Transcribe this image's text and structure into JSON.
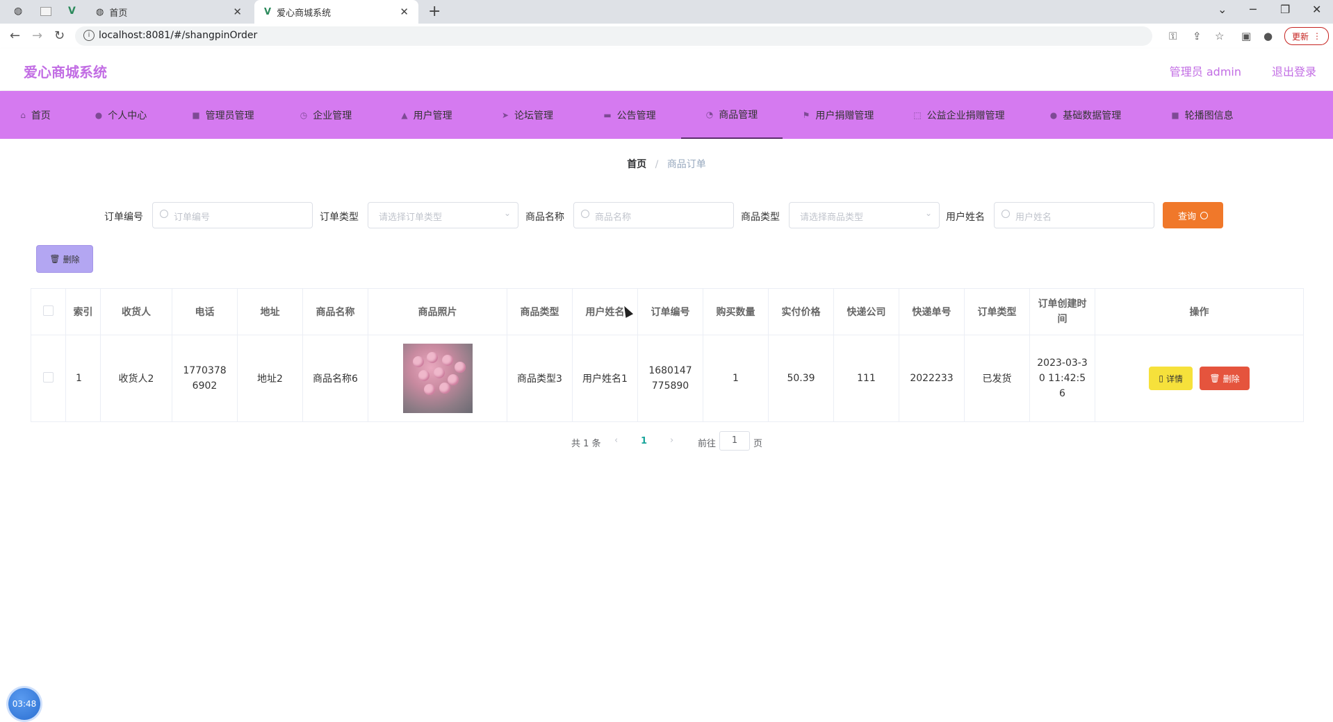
{
  "browser": {
    "tabs": [
      {
        "title": "首页"
      },
      {
        "title": "爱心商城系统"
      }
    ],
    "url": "localhost:8081/#/shangpinOrder",
    "update_label": "更新"
  },
  "header": {
    "app_title": "爱心商城系统",
    "admin_label": "管理员 admin",
    "logout_label": "退出登录"
  },
  "nav": {
    "items": [
      {
        "label": "首页"
      },
      {
        "label": "个人中心"
      },
      {
        "label": "管理员管理"
      },
      {
        "label": "企业管理"
      },
      {
        "label": "用户管理"
      },
      {
        "label": "论坛管理"
      },
      {
        "label": "公告管理"
      },
      {
        "label": "商品管理"
      },
      {
        "label": "用户捐赠管理"
      },
      {
        "label": "公益企业捐赠管理"
      },
      {
        "label": "基础数据管理"
      },
      {
        "label": "轮播图信息"
      }
    ],
    "active": "商品管理"
  },
  "breadcrumb": {
    "home": "首页",
    "separator": "/",
    "current": "商品订单"
  },
  "search": {
    "order_no_label": "订单编号",
    "order_no_placeholder": "订单编号",
    "order_type_label": "订单类型",
    "order_type_placeholder": "请选择订单类型",
    "product_name_label": "商品名称",
    "product_name_placeholder": "商品名称",
    "product_type_label": "商品类型",
    "product_type_placeholder": "请选择商品类型",
    "user_name_label": "用户姓名",
    "user_name_placeholder": "用户姓名",
    "query_label": "查询"
  },
  "toolbar": {
    "delete_label": "删除"
  },
  "table": {
    "columns": [
      "索引",
      "收货人",
      "电话",
      "地址",
      "商品名称",
      "商品照片",
      "商品类型",
      "用户姓名",
      "订单编号",
      "购买数量",
      "实付价格",
      "快递公司",
      "快递单号",
      "订单类型",
      "订单创建时间",
      "操作"
    ],
    "rows": [
      {
        "index": "1",
        "receiver": "收货人2",
        "phone": "17703786902",
        "address": "地址2",
        "product_name": "商品名称6",
        "product_type": "商品类型3",
        "user_name": "用户姓名1",
        "order_no": "1680147775890",
        "quantity": "1",
        "price": "50.39",
        "courier": "111",
        "tracking_no": "2022233",
        "order_type": "已发货",
        "created_at": "2023-03-30 11:42:56",
        "detail_label": "详情",
        "delete_label": "删除"
      }
    ]
  },
  "pagination": {
    "total_text": "共 1 条",
    "current_page": "1",
    "goto_label": "前往",
    "goto_value": "1",
    "page_unit": "页"
  },
  "clock": "03:48"
}
